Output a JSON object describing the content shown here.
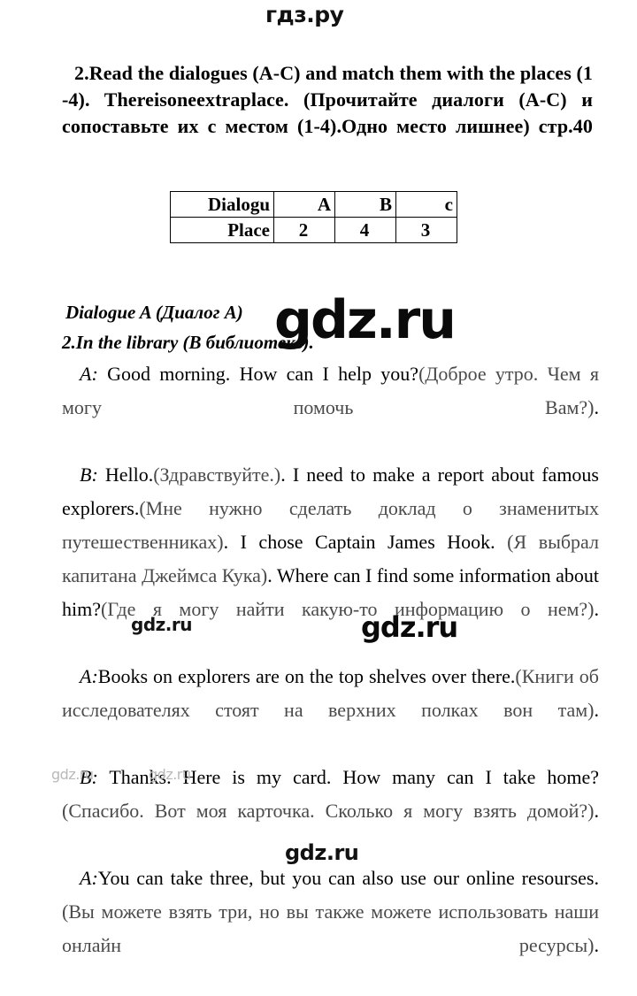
{
  "watermarks": {
    "top": "гдз.ру",
    "big": "gdz.ru",
    "mid_small": "gdz.ru",
    "mid_big": "gdz.ru",
    "faint_a": "gdz.ru",
    "faint_b": "gdz.ru",
    "bottom": "gdz.ru"
  },
  "task": {
    "heading": "2.Read the dialogues (A-C) and match them with the places (1 -4). Thereisoneextraplace. (Прочитайте диалоги (А-С) и сопоставьте их с местом (1-4).Одно место лишнее) стр.40"
  },
  "answers_table": {
    "rows": [
      {
        "label": "Dialogu",
        "values": [
          "A",
          "B",
          "c"
        ]
      },
      {
        "label": "Place",
        "values": [
          "2",
          "4",
          "3"
        ]
      }
    ]
  },
  "dialogue": {
    "title": "Dialogue A (Диалог A)",
    "subtitle": "2.In the library (В библиотеке).",
    "turns": [
      {
        "speaker": "A:",
        "parts": [
          {
            "lang": "en",
            "text": " Good morning. How can I help you?"
          },
          {
            "lang": "ru",
            "text": "(Доброе утро. Чем я могу помочь Вам?)"
          },
          {
            "lang": "en",
            "text": "."
          }
        ]
      },
      {
        "speaker": "B:",
        "parts": [
          {
            "lang": "en",
            "text": " Hello."
          },
          {
            "lang": "ru",
            "text": "(Здравствуйте.)"
          },
          {
            "lang": "en",
            "text": ". I need to make a report about famous explorers."
          },
          {
            "lang": "ru",
            "text": "(Мне нужно сделать доклад о знаменитых путешественниках)"
          },
          {
            "lang": "en",
            "text": ". I chose Captain James Hook. "
          },
          {
            "lang": "ru",
            "text": "(Я выбрал капитана Джеймса Кука)"
          },
          {
            "lang": "en",
            "text": ". Where can I find some information about him?"
          },
          {
            "lang": "ru",
            "text": "(Где я могу найти какую-то информацию о нем?)"
          },
          {
            "lang": "en",
            "text": "."
          }
        ]
      },
      {
        "speaker": "A:",
        "parts": [
          {
            "lang": "en",
            "text": "Books on explorers are on the top shelves over there."
          },
          {
            "lang": "ru",
            "text": "(Книги об исследователях стоят на верхних полках вон там)"
          },
          {
            "lang": "en",
            "text": "."
          }
        ]
      },
      {
        "speaker": "B:",
        "parts": [
          {
            "lang": "en",
            "text": " Thanks. Here is my card. How many can I take home?"
          },
          {
            "lang": "ru",
            "text": "(Спасибо. Вот моя карточка. Сколько я могу взять домой?)"
          },
          {
            "lang": "en",
            "text": "."
          }
        ]
      },
      {
        "speaker": "A:",
        "parts": [
          {
            "lang": "en",
            "text": "You can take three, but you can also use our online resourses."
          },
          {
            "lang": "ru",
            "text": "(Вы можете взять три, но вы также можете использовать наши онлайн ресурсы)"
          },
          {
            "lang": "en",
            "text": "."
          }
        ]
      }
    ]
  }
}
